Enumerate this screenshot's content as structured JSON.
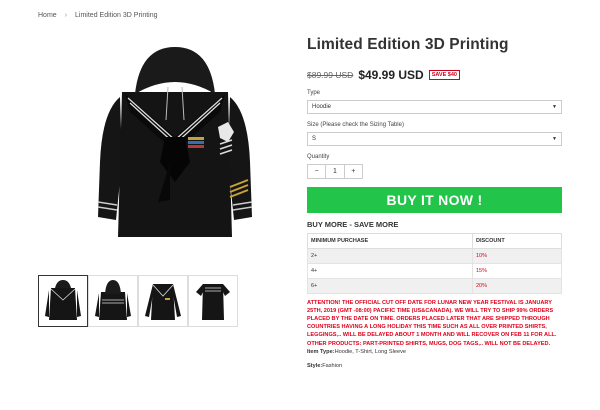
{
  "breadcrumb": {
    "home": "Home",
    "separator": "›",
    "current": "Limited Edition 3D Printing"
  },
  "product": {
    "title": "Limited Edition 3D Printing",
    "old_price": "$89.99 USD",
    "new_price": "$49.99 USD",
    "save_badge": "SAVE $40"
  },
  "options": {
    "type_label": "Type",
    "type_value": "Hoodie",
    "size_label": "Size (Please check the Sizing Table)",
    "size_value": "S",
    "quantity_label": "Quantity",
    "quantity_minus": "−",
    "quantity_value": "1",
    "quantity_plus": "+"
  },
  "buy_button": "BUY IT NOW !",
  "buy_more": {
    "heading": "BUY MORE - SAVE MORE",
    "col_min": "MINIMUM PURCHASE",
    "col_discount": "DISCOUNT",
    "rows": [
      {
        "min": "2+",
        "discount": "10%"
      },
      {
        "min": "4+",
        "discount": "15%"
      },
      {
        "min": "6+",
        "discount": "20%"
      }
    ]
  },
  "notice": "ATTENTION! THE OFFICIAL CUT OFF DATE FOR LUNAR NEW YEAR FESTIVAL IS JANUARY 25TH, 2019 (GMT -08:00) PACIFIC TIME (US&CANADA). WE WILL TRY TO SHIP 99% ORDERS PLACED BY THE DATE ON TIME. ORDERS PLACED LATER THAT ARE SHIPPED THROUGH COUNTRIES HAVING A LONG HOLIDAY THIS TIME SUCH AS ALL OVER PRINTED SHIRTS, LEGGINGS,.. WILL BE DELAYED ABOUT 1 MONTH AND WILL RECOVER ON FEB 11 FOR ALL. OTHER PRODUCTS: PART-PRINTED SHIRTS, MUGS, DOG TAGS,.. WILL NOT BE DELAYED.",
  "item_type": {
    "label": "Item Type:",
    "value": "Hoodie, T-Shirt, Long Sleeve"
  },
  "style": {
    "label": "Style:",
    "value": "Fashion"
  },
  "colors": {
    "buy": "#22c44a",
    "accent_red": "#d0021b",
    "garment": "#111111"
  }
}
